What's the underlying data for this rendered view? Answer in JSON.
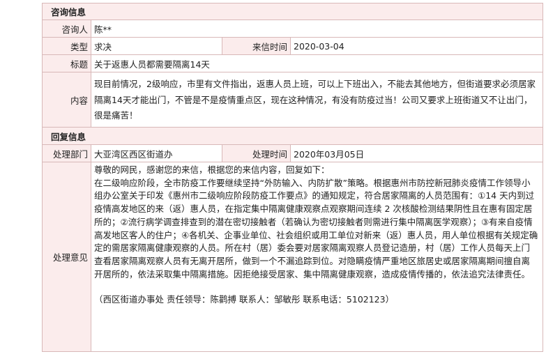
{
  "consult": {
    "section_title": "咨询信息",
    "person_label": "咨询人",
    "person_value": "陈**",
    "type_label": "类型",
    "type_value": "求决",
    "date_label": "来信时间",
    "date_value": "2020-03-04",
    "title_label": "标题",
    "title_value": "关于返惠人员都需要隔离14天",
    "content_label": "内容",
    "content_value": "现目前情况，2级响应，市里有文件指出，返惠人员上班，可以上下班出入，不能去其他地方，但街道要求必须居家隔离14天才能出门，不管是不是疫情重点区，现在这种情况，有没有防疫过当！公司又要求上班街道又不让出门，很是痛苦！"
  },
  "reply": {
    "section_title": "回复信息",
    "dept_label": "处理部门",
    "dept_value": "大亚湾区西区街道办",
    "time_label": "处理时间",
    "time_value": "2020年03月05日",
    "opinion_label": "处理意见",
    "greeting": "尊敬的网民，感谢您的来信，根据您的来信内容，回复如下：",
    "body": "在二级响应阶段，全市防疫工作要继续坚持“外防输入、内防扩散”策略。根据惠州市防控新冠肺炎疫情工作领导小组办公室关于印发《惠州市二级响应阶段防疫工作要点》的通知规定，符合居家隔离的人员范围有：①14 天内到过疫情高发地区的来（返）惠人员，在指定集中隔离健康观察点观察期间连续 2 次核酸检测结果阴性且在惠有固定居所的；②流行病学调查排查到的潜在密切接触者（若确认为密切接触者则需进行集中隔离医学观察）；③有来自疫情高发地区客人的住户；④各机关、企事业单位、社会组织或用工单位对新来（返）惠人员，用人单位根据有关规定确定的需居家隔离健康观察的人员。所在村（居）委会要对居家隔离观察人员登记造册，村（居）工作人员每天上门查看居家隔离观察人员有无离开居所，做到一个不漏追踪到位。对隐瞒疫情严重地区旅居史或居家隔离期间擅自离开居所的，依法采取集中隔离措施。因拒绝接受居家、集中隔离健康观察，造成疫情传播的，依法追究法律责任。",
    "signature": "（西区街道办事处 责任领导：陈鹳搏 联系人：邹敏彤 联系电话：5102123）"
  }
}
